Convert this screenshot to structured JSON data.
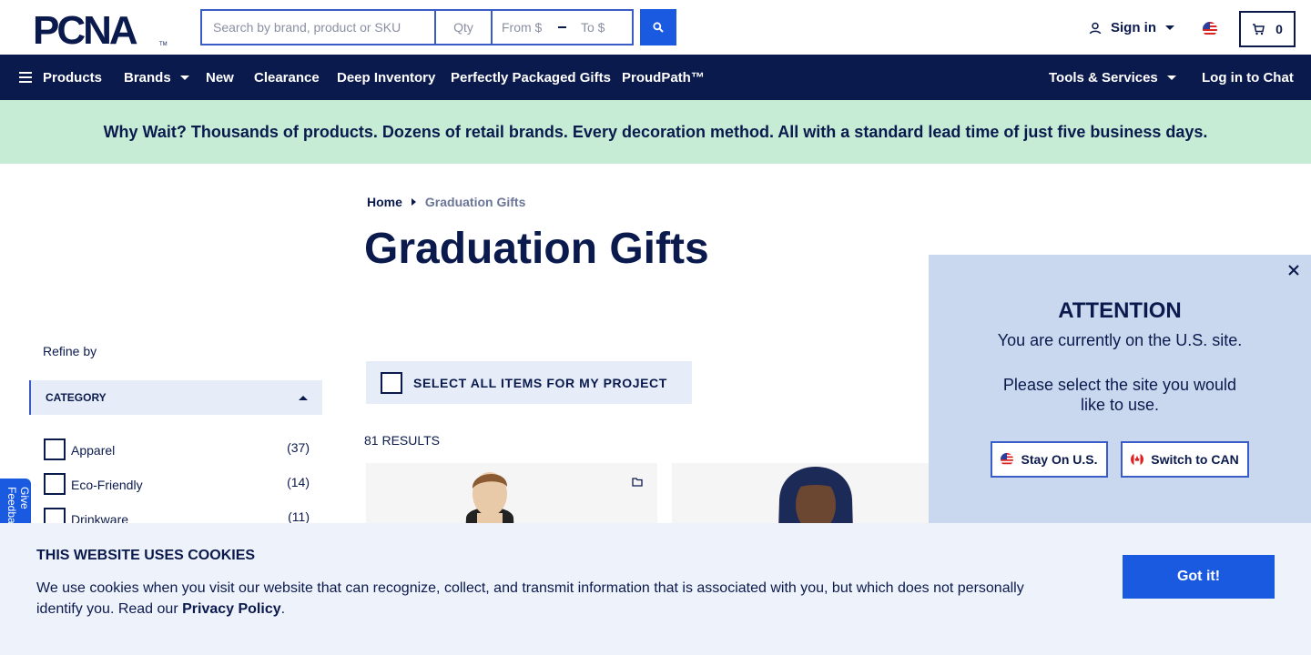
{
  "header": {
    "logo_text": "PCNA",
    "search_placeholder": "Search by brand, product or SKU",
    "qty_placeholder": "Qty",
    "price_from_placeholder": "From $",
    "price_to_placeholder": "To $",
    "sign_in_label": "Sign in",
    "cart_count": "0"
  },
  "nav": {
    "products": "Products",
    "brands": "Brands",
    "new": "New",
    "clearance": "Clearance",
    "deep_inventory": "Deep Inventory",
    "perfectly_packaged": "Perfectly Packaged Gifts",
    "proudpath": "ProudPath™",
    "tools_services": "Tools & Services",
    "log_in_chat": "Log in to Chat"
  },
  "promo": {
    "text": "Why Wait? Thousands of products. Dozens of retail brands. Every decoration method. All with a standard lead time of just five business days."
  },
  "breadcrumb": {
    "home": "Home",
    "current": "Graduation Gifts"
  },
  "page": {
    "title": "Graduation Gifts",
    "select_all_label": "SELECT ALL ITEMS FOR MY PROJECT",
    "results_label": "81 RESULTS"
  },
  "sidebar": {
    "refine_label": "Refine by",
    "category_header": "CATEGORY",
    "categories": [
      {
        "label": "Apparel",
        "count": "(37)"
      },
      {
        "label": "Eco-Friendly",
        "count": "(14)"
      },
      {
        "label": "Drinkware",
        "count": "(11)"
      }
    ],
    "feedback_label": "Give Feedback"
  },
  "modal": {
    "title": "ATTENTION",
    "text1": "You are currently on the U.S. site.",
    "text2": "Please select the site you would like to use.",
    "stay_label": "Stay On U.S.",
    "switch_label": "Switch to CAN"
  },
  "cookie": {
    "title": "THIS WEBSITE USES COOKIES",
    "text": "We use cookies when you visit our website that can recognize, collect, and transmit information that is associated with you, but which does not personally identify you. Read our ",
    "link": "Privacy Policy",
    "text_end": ".",
    "button": "Got it!"
  },
  "colors": {
    "navy": "#0b1a4d",
    "accent_blue": "#1a5ae0",
    "promo_green": "#c6ecd6",
    "modal_bg": "#c9d8ee"
  }
}
